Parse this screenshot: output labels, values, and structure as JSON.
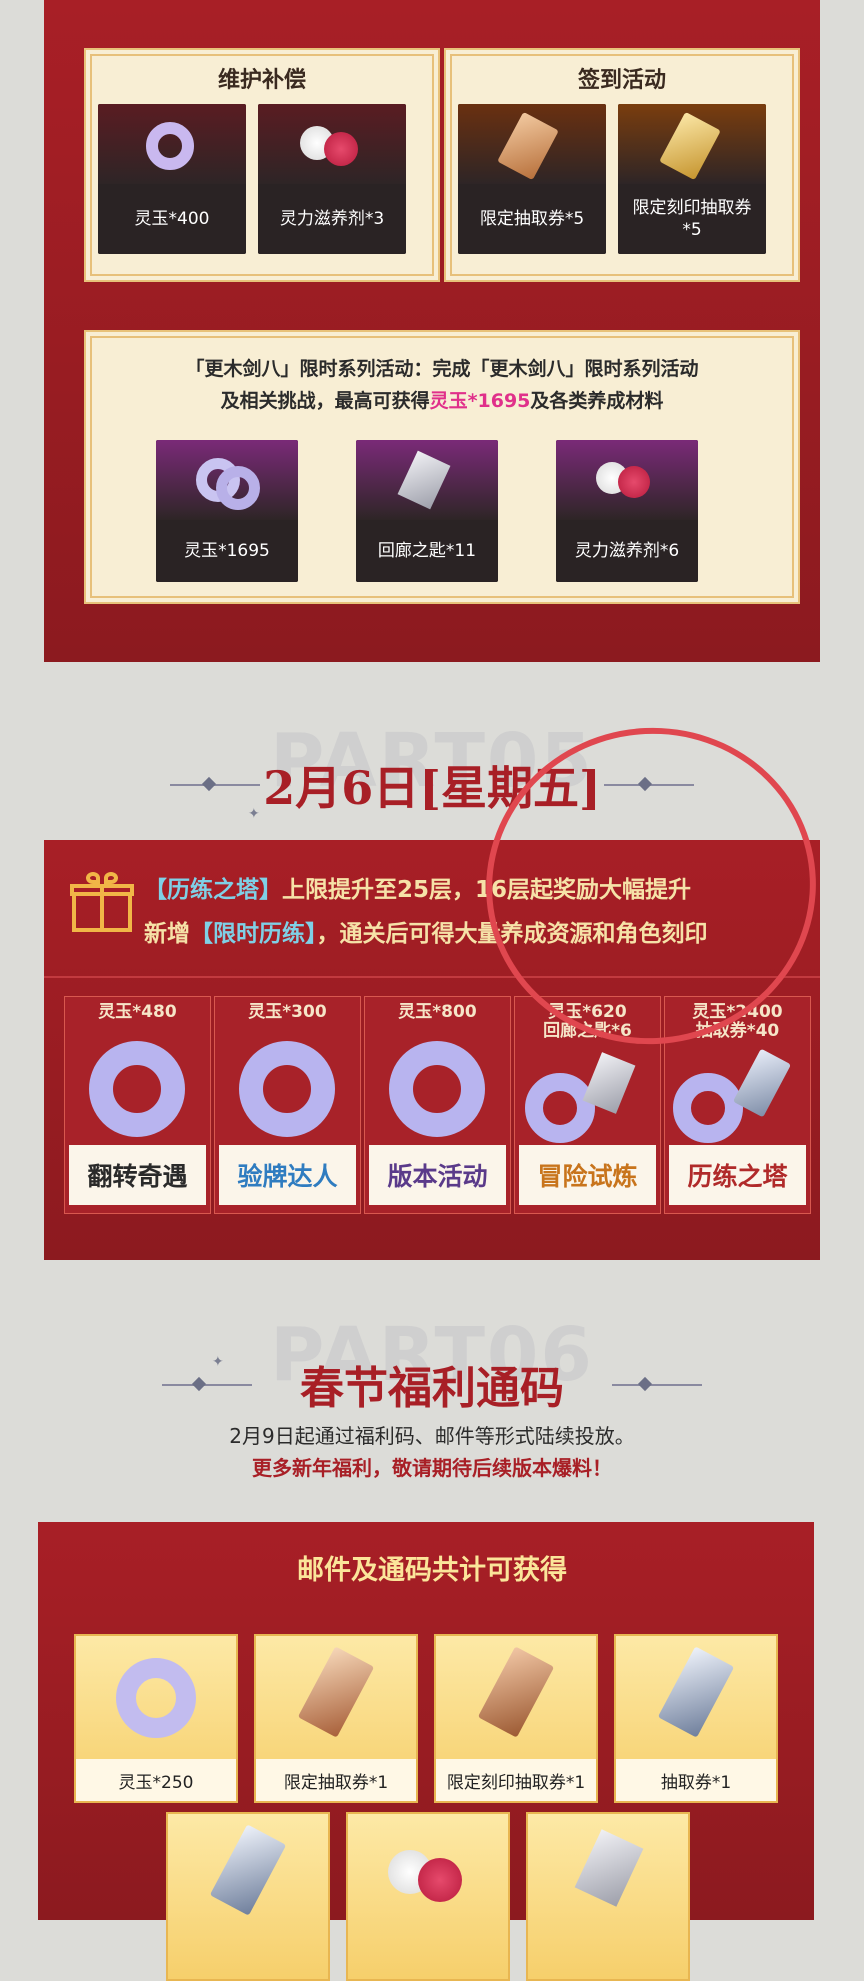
{
  "section_top": {
    "maintenance": {
      "title": "维护补偿",
      "items": [
        {
          "label": "灵玉*400",
          "icon": "jade-ring-icon"
        },
        {
          "label": "灵力滋养剂*3",
          "icon": "red-orb-icon"
        }
      ]
    },
    "signin": {
      "title": "签到活动",
      "items": [
        {
          "label": "限定抽取券*5",
          "icon": "ticket-icon"
        },
        {
          "label": "限定刻印抽取券*5",
          "icon": "gold-ticket-icon"
        }
      ]
    },
    "series": {
      "text_a": "「更木剑八」限时系列活动：完成「更木剑八」限时系列活动",
      "text_b1": "及相关挑战，最高可获得",
      "text_highlight": "灵玉*1695",
      "text_b2": "及各类养成材料",
      "items": [
        {
          "label": "灵玉*1695",
          "icon": "jade-stack-icon"
        },
        {
          "label": "回廊之匙*11",
          "icon": "key-tag-icon"
        },
        {
          "label": "灵力滋养剂*6",
          "icon": "red-orb-icon"
        }
      ]
    }
  },
  "part5": {
    "watermark": "PART05",
    "date": "2月6日[星期五]",
    "banner": {
      "tag1": "【历练之塔】",
      "line1": "上限提升至25层，16层起奖励大幅提升",
      "prefix2": "新增",
      "tag2": "【限时历练】",
      "line2": "，通关后可得大量养成资源和角色刻印"
    },
    "cards": [
      {
        "value": "灵玉*480",
        "label": "翻转奇遇",
        "color": "#2a2a2a"
      },
      {
        "value": "灵玉*300",
        "label": "验牌达人",
        "color": "#2f7cc0"
      },
      {
        "value": "灵玉*800",
        "label": "版本活动",
        "color": "#5a3a8a"
      },
      {
        "value": "灵玉*620\n回廊之匙*6",
        "label": "冒险试炼",
        "color": "#c8741c"
      },
      {
        "value": "灵玉*2400\n抽取券*40",
        "label": "历练之塔",
        "color": "#b02a2a"
      }
    ]
  },
  "part6": {
    "watermark": "PART06",
    "title": "春节福利通码",
    "line1": "2月9日起通过福利码、邮件等形式陆续投放。",
    "line2": "更多新年福利，敬请期待后续版本爆料！",
    "panel_title": "邮件及通码共计可获得",
    "row1": [
      {
        "label": "灵玉*250"
      },
      {
        "label": "限定抽取券*1"
      },
      {
        "label": "限定刻印抽取券*1"
      },
      {
        "label": "抽取券*1"
      }
    ]
  },
  "colors": {
    "accent_red": "#a81f26",
    "pink_highlight": "#e0308a",
    "gold": "#f6cf6b",
    "circle": "#e0474f"
  }
}
